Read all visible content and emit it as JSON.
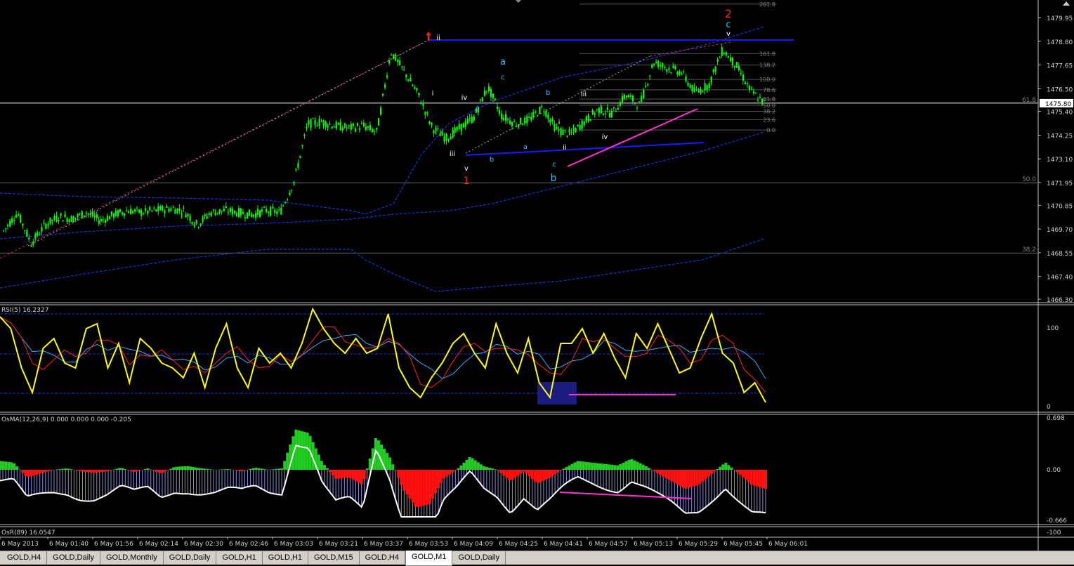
{
  "chart_data": [
    {
      "type": "candlestick",
      "symbol": "GOLD",
      "timeframe": "M1",
      "price_ticks": [
        "1479.95",
        "1478.80",
        "1477.65",
        "1476.50",
        "1475.80",
        "1475.40",
        "1474.25",
        "1473.10",
        "1471.95",
        "1470.85",
        "1469.70",
        "1468.55",
        "1467.40",
        "1466.30"
      ],
      "current_price": "1475.80",
      "fibo_left_levels": [
        "61.8",
        "50.0",
        "38.2"
      ],
      "fibo_right_levels": [
        "261.8",
        "161.8",
        "138.2",
        "100.0",
        "78.6",
        "61.8",
        "50.0",
        "38.2",
        "23.6",
        "0.0"
      ],
      "wave_labels": [
        "ii",
        "i",
        "iv",
        "iii",
        "v",
        "1",
        "a",
        "c",
        "a",
        "b",
        "b",
        "a",
        "c",
        "b",
        "i",
        "iii",
        "ii",
        "iv",
        "2",
        "c",
        "v"
      ],
      "approx_price_path": [
        1469.6,
        1470.5,
        1469.0,
        1469.9,
        1470.3,
        1470.2,
        1470.5,
        1470.1,
        1470.4,
        1470.6,
        1470.5,
        1470.6,
        1470.7,
        1470.6,
        1469.9,
        1470.5,
        1470.6,
        1470.5,
        1470.4,
        1470.6,
        1470.5,
        1472.0,
        1474.8,
        1474.9,
        1474.7,
        1474.6,
        1474.7,
        1474.4,
        1478.3,
        1477.3,
        1476.2,
        1474.6,
        1474.1,
        1474.6,
        1475.1,
        1476.6,
        1475.2,
        1474.8,
        1475.0,
        1475.6,
        1474.5,
        1474.3,
        1474.9,
        1475.5,
        1475.3,
        1476.2,
        1475.7,
        1477.8,
        1477.5,
        1477.3,
        1476.3,
        1476.7,
        1478.4,
        1477.6,
        1476.4,
        1475.8
      ]
    },
    {
      "type": "line",
      "title": "RSI(5) 16.2327",
      "ytick_labels": [
        "100",
        "0"
      ],
      "approx_values": [
        92,
        80,
        40,
        15,
        60,
        70,
        45,
        40,
        80,
        85,
        40,
        65,
        25,
        70,
        60,
        45,
        40,
        30,
        55,
        20,
        60,
        85,
        40,
        20,
        60,
        45,
        55,
        40,
        65,
        100,
        80,
        65,
        55,
        70,
        55,
        60,
        95,
        40,
        20,
        10,
        30,
        45,
        65,
        75,
        55,
        40,
        85,
        55,
        35,
        70,
        25,
        10,
        65,
        65,
        80,
        55,
        75,
        50,
        30,
        75,
        60,
        85,
        60,
        35,
        40,
        70,
        95,
        55,
        45,
        15,
        25,
        5
      ]
    },
    {
      "type": "bar",
      "title": "OsMA(12,26,9) 0.000 0.000 0.000 -0.205",
      "ytick_labels": [
        "0.698",
        "0.00",
        "-0.666"
      ],
      "approx_values": [
        0.12,
        0.1,
        -0.1,
        -0.05,
        0.0,
        0.02,
        -0.02,
        -0.04,
        -0.02,
        0.03,
        -0.03,
        0.02,
        -0.05,
        0.04,
        0.05,
        0.02,
        0.0,
        0.01,
        -0.02,
        0.03,
        0.0,
        0.02,
        0.55,
        0.5,
        0.1,
        -0.12,
        -0.1,
        -0.2,
        0.45,
        0.18,
        -0.25,
        -0.5,
        -0.45,
        -0.12,
        0.0,
        0.18,
        0.05,
        0.0,
        -0.15,
        -0.02,
        -0.18,
        -0.1,
        0.02,
        0.12,
        0.1,
        0.08,
        0.06,
        0.15,
        0.06,
        -0.05,
        -0.15,
        -0.25,
        -0.2,
        -0.05,
        0.1,
        -0.05,
        -0.2,
        -0.25
      ]
    }
  ],
  "bottom_indicator": {
    "label": "OsR(89) 16.0547"
  },
  "x_labels": [
    "6 May 2013",
    "6 May 01:40",
    "6 May 01:56",
    "6 May 02:14",
    "6 May 02:30",
    "6 May 02:46",
    "6 May 03:03",
    "6 May 03:21",
    "6 May 03:37",
    "6 May 03:53",
    "6 May 04:09",
    "6 May 04:25",
    "6 May 04:41",
    "6 May 04:57",
    "6 May 05:13",
    "6 May 05:29",
    "6 May 05:45",
    "6 May 06:01"
  ],
  "side_scale": {
    "bottom_label": "-100"
  },
  "tabs": [
    {
      "label": "GOLD,H4",
      "active": false
    },
    {
      "label": "GOLD,Daily",
      "active": false
    },
    {
      "label": "GOLD,Monthly",
      "active": false
    },
    {
      "label": "GOLD,Daily",
      "active": false
    },
    {
      "label": "GOLD,H1",
      "active": false
    },
    {
      "label": "GOLD,H1",
      "active": false
    },
    {
      "label": "GOLD,M15",
      "active": false
    },
    {
      "label": "GOLD,H4",
      "active": false
    },
    {
      "label": "GOLD,M1",
      "active": true
    },
    {
      "label": "GOLD,Daily",
      "active": false
    }
  ],
  "colors": {
    "background": "#000000",
    "candle": "#00ff00",
    "ema_blue": "#1f2fd0",
    "trend_blue": "#1a1aff",
    "magenta": "#ff33cc",
    "rsi_line": "#ffff00",
    "rsi_red": "#ff2020",
    "rsi_cyan": "#33aaff",
    "osma_green": "#22cc22",
    "osma_red": "#ff1111",
    "osma_line": "#ffffff",
    "wave_red": "#ff2020",
    "wave_cyan": "#33bbff",
    "fib_grey": "#808080"
  }
}
